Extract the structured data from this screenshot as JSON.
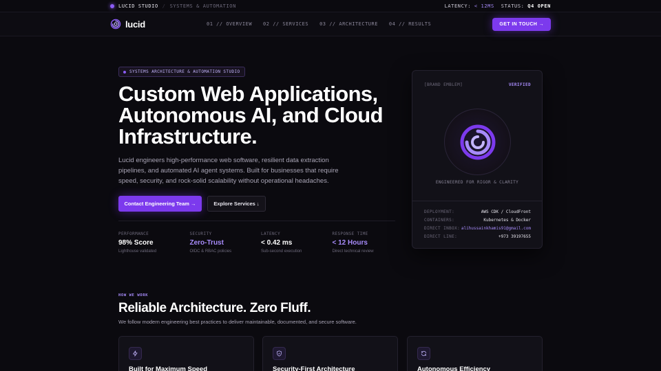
{
  "topbar": {
    "brand": "LUCID STUDIO",
    "separator": "/",
    "tagline": "SYSTEMS & AUTOMATION",
    "latency_label": "LATENCY:",
    "latency_value": "< 12MS",
    "status_label": "STATUS:",
    "status_value": "Q4 OPEN"
  },
  "nav": {
    "logo_text": "lucid",
    "links": [
      "01 // OVERVIEW",
      "02 // SERVICES",
      "03 // ARCHITECTURE",
      "04 // RESULTS"
    ],
    "cta_label": "GET IN TOUCH →"
  },
  "hero": {
    "badge": "SYSTEMS ARCHITECTURE & AUTOMATION STUDIO",
    "title_lines": [
      "Custom Web Applications,",
      "Autonomous AI, and Cloud",
      "Infrastructure."
    ],
    "description": "Lucid engineers high-performance web software, resilient data extraction pipelines, and automated AI agent systems. Built for businesses that require speed, security, and rock-solid scalability without operational headaches.",
    "primary_button": "Contact Engineering Team →",
    "secondary_button": "Explore Services ↓",
    "stats": [
      {
        "label": "PERFORMANCE",
        "value": "98% Score",
        "sub": "Lighthouse validated",
        "accent": false
      },
      {
        "label": "SECURITY",
        "value": "Zero-Trust",
        "sub": "OIDC & RBAC policies",
        "accent": true
      },
      {
        "label": "LATENCY",
        "value": "< 0.42 ms",
        "sub": "Sub-second execution",
        "accent": false
      },
      {
        "label": "RESPONSE TIME",
        "value": "< 12 Hours",
        "sub": "Direct technical review",
        "accent": true
      }
    ]
  },
  "card": {
    "head_left": "[BRAND EMBLEM]",
    "head_right": "VERIFIED",
    "caption": "ENGINEERED FOR RIGOR & CLARITY",
    "rows": [
      {
        "key": "DEPLOYMENT:",
        "value": "AWS CDK / CloudFront",
        "accent": false
      },
      {
        "key": "CONTAINERS:",
        "value": "Kubernetes & Docker",
        "accent": false
      },
      {
        "key": "DIRECT INBOX:",
        "value": "alihussainkhamis91@gmail.com",
        "accent": true
      },
      {
        "key": "DIRECT LINE:",
        "value": "+973 39197655",
        "accent": false
      }
    ]
  },
  "how_we_work": {
    "label": "HOW WE WORK",
    "title": "Reliable Architecture. Zero Fluff.",
    "description": "We follow modern engineering best practices to deliver maintainable, documented, and secure software.",
    "features": [
      {
        "icon": "lightning-icon",
        "title": "Built for Maximum Speed"
      },
      {
        "icon": "shield-icon",
        "title": "Security-First Architecture"
      },
      {
        "icon": "refresh-icon",
        "title": "Autonomous Efficiency"
      }
    ]
  },
  "colors": {
    "accent": "#7c3aed",
    "accent_light": "#a78bfa",
    "background": "#0b0a0f"
  }
}
